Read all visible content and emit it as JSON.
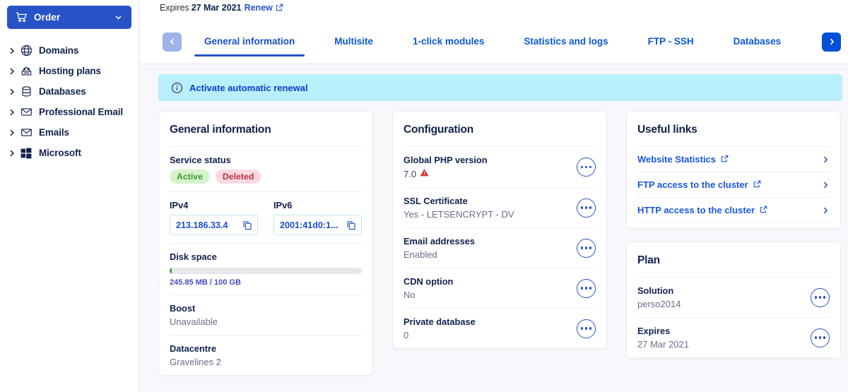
{
  "sidebar": {
    "order_button": {
      "label": "Order",
      "icon": "cart-icon",
      "chevron": "chevron-down-icon"
    },
    "items": [
      {
        "label": "Domains",
        "icon": "globe-icon"
      },
      {
        "label": "Hosting plans",
        "icon": "hosting-icon"
      },
      {
        "label": "Databases",
        "icon": "database-icon"
      },
      {
        "label": "Professional Email",
        "icon": "envelope-icon"
      },
      {
        "label": "Emails",
        "icon": "envelope-icon"
      },
      {
        "label": "Microsoft",
        "icon": "microsoft-icon"
      }
    ]
  },
  "header": {
    "expires_label": "Expires",
    "expires_date": "27 Mar 2021",
    "renew_label": "Renew",
    "external_icon": "external-link-icon"
  },
  "tabs": {
    "prev_icon": "chevron-left-icon",
    "next_icon": "chevron-right-icon",
    "items": [
      {
        "label": "General information",
        "active": true
      },
      {
        "label": "Multisite",
        "active": false
      },
      {
        "label": "1-click modules",
        "active": false
      },
      {
        "label": "Statistics and logs",
        "active": false
      },
      {
        "label": "FTP - SSH",
        "active": false
      },
      {
        "label": "Databases",
        "active": false
      }
    ]
  },
  "banner": {
    "icon": "info-icon",
    "text": "Activate automatic renewal",
    "background": "#b9eefb"
  },
  "general_information": {
    "title": "General information",
    "service_status": {
      "label": "Service status",
      "badges": [
        {
          "text": "Active",
          "color": "#3a9a2f",
          "background": "#d7f3cb"
        },
        {
          "text": "Deleted",
          "color": "#b8313f",
          "background": "#fbd9e2"
        }
      ]
    },
    "ipv4": {
      "label": "IPv4",
      "value": "213.186.33.4",
      "copy_icon": "copy-icon"
    },
    "ipv6": {
      "label": "IPv6",
      "value": "2001:41d0:1...",
      "copy_icon": "copy-icon"
    },
    "disk_space": {
      "label": "Disk space",
      "used_text": "245.85 MB / 100 GB",
      "percent": 0.25,
      "fill_color": "#3ea23a"
    },
    "boost": {
      "label": "Boost",
      "value": "Unavailable"
    },
    "datacentre": {
      "label": "Datacentre",
      "value": "Gravelines 2"
    }
  },
  "configuration": {
    "title": "Configuration",
    "rows": [
      {
        "label": "Global PHP version",
        "value": "7.0",
        "warning": true,
        "menu_icon": "more-options-icon"
      },
      {
        "label": "SSL Certificate",
        "value": "Yes - LETSENCRYPT - DV",
        "warning": false,
        "menu_icon": "more-options-icon"
      },
      {
        "label": "Email addresses",
        "value": "Enabled",
        "warning": false,
        "menu_icon": "more-options-icon"
      },
      {
        "label": "CDN option",
        "value": "No",
        "warning": false,
        "menu_icon": "more-options-icon"
      },
      {
        "label": "Private database",
        "value": "0",
        "warning": false,
        "menu_icon": "more-options-icon"
      }
    ]
  },
  "useful_links": {
    "title": "Useful links",
    "links": [
      {
        "label": "Website Statistics",
        "external_icon": "external-link-icon",
        "chevron": "chevron-right-icon"
      },
      {
        "label": "FTP access to the cluster",
        "external_icon": "external-link-icon",
        "chevron": "chevron-right-icon"
      },
      {
        "label": "HTTP access to the cluster",
        "external_icon": "external-link-icon",
        "chevron": "chevron-right-icon"
      }
    ]
  },
  "plan": {
    "title": "Plan",
    "rows": [
      {
        "label": "Solution",
        "value": "perso2014",
        "menu_icon": "more-options-icon"
      },
      {
        "label": "Expires",
        "value": "27 Mar 2021",
        "menu_icon": "more-options-icon"
      }
    ]
  },
  "colors": {
    "brand_blue": "#2853c6",
    "link_blue": "#1a56e0",
    "navy": "#10214b",
    "page_bg": "#f8f8fc"
  }
}
